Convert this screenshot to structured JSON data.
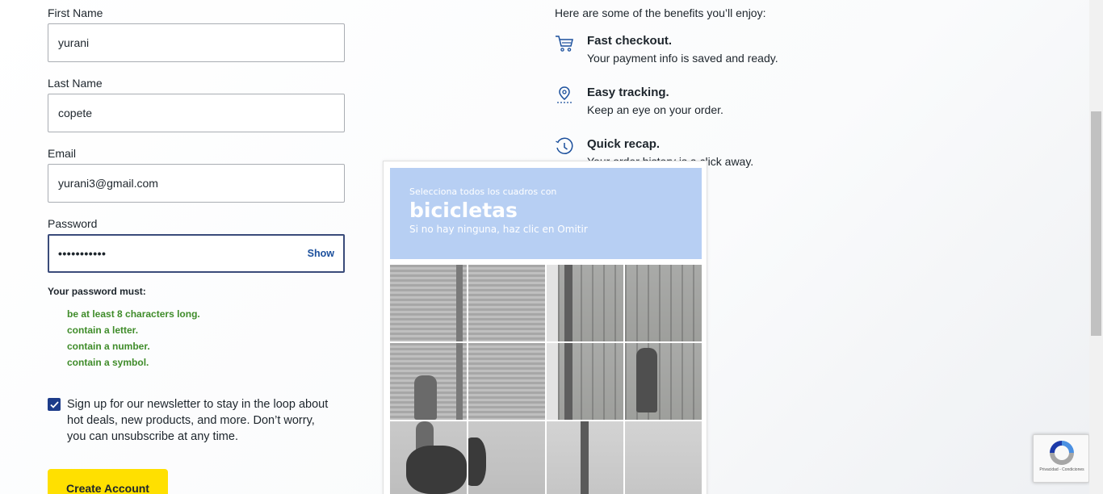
{
  "form": {
    "first_name": {
      "label": "First Name",
      "value": "yurani"
    },
    "last_name": {
      "label": "Last Name",
      "value": "copete"
    },
    "email": {
      "label": "Email",
      "value": "yurani3@gmail.com"
    },
    "password": {
      "label": "Password",
      "masked_value": "•••••••••••",
      "show_label": "Show"
    },
    "rules_title": "Your password must:",
    "rules": [
      "be at least 8 characters long.",
      "contain a letter.",
      "contain a number.",
      "contain a symbol."
    ],
    "rule_color": "#3f8c2a",
    "newsletter": {
      "checked": true,
      "text": "Sign up for our newsletter to stay in the loop about hot deals, new products, and more. Don’t worry, you can unsubscribe at any time."
    },
    "create_button": "Create Account",
    "create_button_color": "#ffe000"
  },
  "benefits": {
    "intro": "Here are some of the benefits you’ll enjoy:",
    "items": [
      {
        "icon": "cart-icon",
        "title": "Fast checkout.",
        "text": "Your payment info is saved and ready."
      },
      {
        "icon": "location-pin-icon",
        "title": "Easy tracking.",
        "text": "Keep an eye on your order."
      },
      {
        "icon": "clock-history-icon",
        "title": "Quick recap.",
        "text": "Your order history is a click away."
      }
    ],
    "icon_color": "#1b4f9c"
  },
  "captcha": {
    "line1": "Selecciona todos los cuadros con",
    "keyword": "bicicletas",
    "line3": "Si no hay ninguna, haz clic en Omitir",
    "header_color": "#b7cff3",
    "grid": {
      "rows": 3,
      "cols": 4
    }
  },
  "recaptcha_badge": {
    "text": "Privacidad - Condiciones"
  }
}
